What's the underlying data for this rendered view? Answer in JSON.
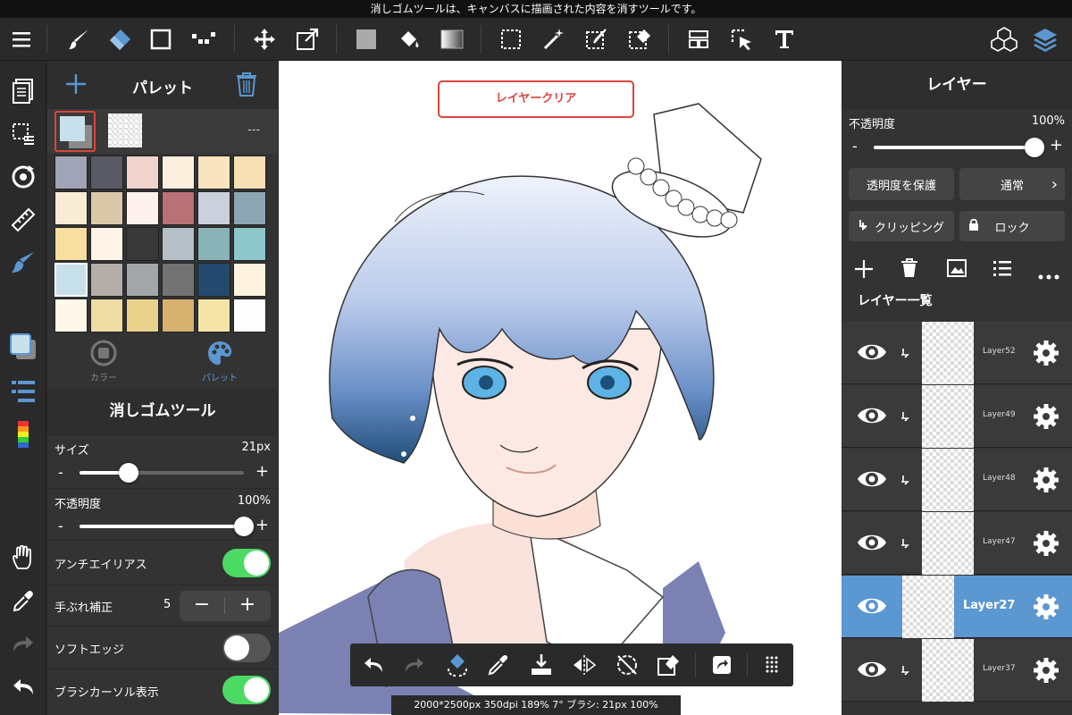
{
  "status_bar": {
    "message": "消しゴムツールは、キャンバスに描画された内容を消すツールです。"
  },
  "toolbar": {
    "tools": [
      "menu-icon",
      "brush-icon",
      "eraser-icon",
      "rectangle-icon",
      "dot-icon",
      "move-icon",
      "transform-icon",
      "fill-color-icon",
      "bucket-icon",
      "gradient-icon",
      "select-rect-icon",
      "magic-wand-icon",
      "select-pen-icon",
      "select-eraser-icon",
      "frame-icon",
      "operation-icon",
      "text-icon",
      "3d-icon",
      "layers-icon"
    ]
  },
  "palette_panel": {
    "title": "パレット",
    "current_label": "---",
    "tabs": [
      {
        "label": "カラー"
      },
      {
        "label": "パレット"
      }
    ],
    "swatches": [
      "#a0a4b4",
      "#5a5a66",
      "#efd3cc",
      "#fdefde",
      "#f8e4be",
      "#f6dfb5",
      "#f8ecd4",
      "#dbc8a8",
      "#fff1ee",
      "#b97077",
      "#cbd0dd",
      "#8ca5b2",
      "#f8df9f",
      "#fff4e7",
      "#383838",
      "#b5bfc7",
      "#8ab3b8",
      "#8ec7cb",
      "#c7e0ea",
      "#b5adaa",
      "#a3a6a8",
      "#737373",
      "#23496e",
      "#fef3df",
      "#fff7ea",
      "#eedda5",
      "#e9d28c",
      "#d6b170",
      "#f5e4a8",
      "#fefefe"
    ]
  },
  "tool_panel": {
    "title": "消しゴムツール",
    "size_label": "サイズ",
    "size_value": "21px",
    "size_fraction": 0.3,
    "opacity_label": "不透明度",
    "opacity_value": "100%",
    "opacity_fraction": 1.0,
    "antialias_label": "アンチエイリアス",
    "antialias_on": true,
    "stabilizer_label": "手ぶれ補正",
    "stabilizer_value": "5",
    "soft_edge_label": "ソフトエッジ",
    "soft_edge_on": false,
    "cursor_label": "ブラシカーソル表示",
    "cursor_on": true
  },
  "canvas": {
    "clear_button_label": "レイヤークリア"
  },
  "layers_panel": {
    "title": "レイヤー",
    "opacity_label": "不透明度",
    "opacity_value": "100%",
    "opacity_fraction": 1.0,
    "protect_label": "透明度を保護",
    "blend_label": "通常",
    "clipping_label": "クリッピング",
    "lock_label": "ロック",
    "list_title": "レイヤー一覧",
    "layers": [
      {
        "name": "Layer52",
        "selected": false
      },
      {
        "name": "Layer49",
        "selected": false
      },
      {
        "name": "Layer48",
        "selected": false
      },
      {
        "name": "Layer47",
        "selected": false
      },
      {
        "name": "Layer27",
        "selected": true
      },
      {
        "name": "Layer37",
        "selected": false
      }
    ]
  },
  "info_bar": {
    "text": "2000*2500px 350dpi 189% 7° ブラシ: 21px 100%"
  },
  "colors": {
    "accent": "#5b97d1",
    "toggle_on": "#4cd964",
    "clear_border": "#d9453e"
  }
}
